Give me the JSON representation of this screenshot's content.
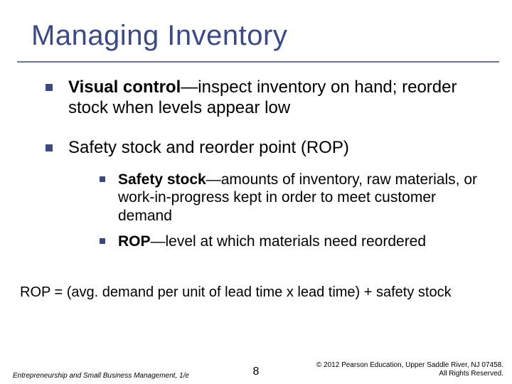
{
  "title": "Managing Inventory",
  "bullets": {
    "b1_strong": "Visual control",
    "b1_rest": "—inspect inventory on hand; reorder stock when levels appear low",
    "b2": "Safety stock and reorder point (ROP)",
    "sub1_strong": "Safety stock",
    "sub1_rest": "—amounts of inventory, raw materials, or work-in-progress kept in order to meet customer demand",
    "sub2_strong": "ROP",
    "sub2_rest": "—level at which materials need reordered"
  },
  "formula": "ROP = (avg. demand per unit of lead time x lead time) + safety stock",
  "footer": {
    "left": "Entrepreneurship and Small Business Management, 1/e",
    "page": "8",
    "right1": "© 2012 Pearson Education, Upper Saddle River, NJ 07458.",
    "right2": "All Rights Reserved."
  }
}
